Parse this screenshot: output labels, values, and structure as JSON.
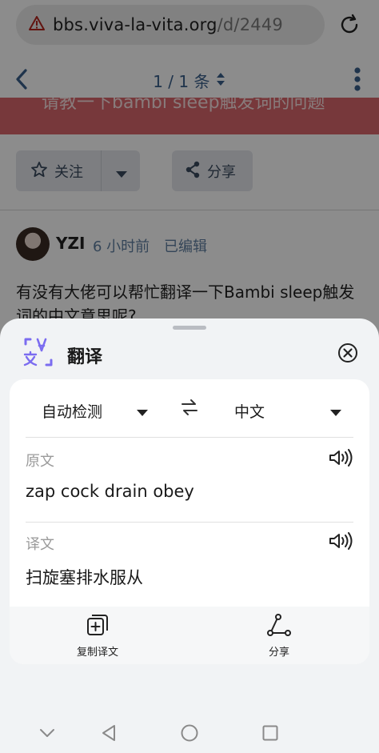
{
  "browser": {
    "url_host": "bbs.viva-la-vita.org",
    "url_path": "/d/2449",
    "icons": {
      "warning": "warning-triangle-icon",
      "reload": "reload-icon"
    }
  },
  "topic_nav": {
    "pager": "1 / 1 条",
    "icons": {
      "back": "chevron-left-icon",
      "pager": "sort-arrows-icon",
      "menu": "more-vertical-icon"
    }
  },
  "topic_title_partial": "请教一下bambi sleep触发词的问题",
  "actions_bar": {
    "follow_label": "关注",
    "share_label": "分享"
  },
  "post": {
    "username": "YZI",
    "time": "6 小时前",
    "edited": "已编辑",
    "text": "有没有大佬可以帮忙翻译一下Bambi sleep触发词的中文意思呢?"
  },
  "translate_sheet": {
    "title": "翻译",
    "source_language": "自动检测",
    "target_language": "中文",
    "source_label": "原文",
    "source_text": "zap cock drain obey",
    "target_label": "译文",
    "target_text": "扫旋塞排水服从",
    "copy_label": "复制译文",
    "share_label": "分享",
    "accent_color": "#7b6cf0"
  },
  "system_nav": {
    "icons": [
      "chevron-down-icon",
      "back-triangle-icon",
      "home-circle-icon",
      "recents-square-icon"
    ]
  }
}
